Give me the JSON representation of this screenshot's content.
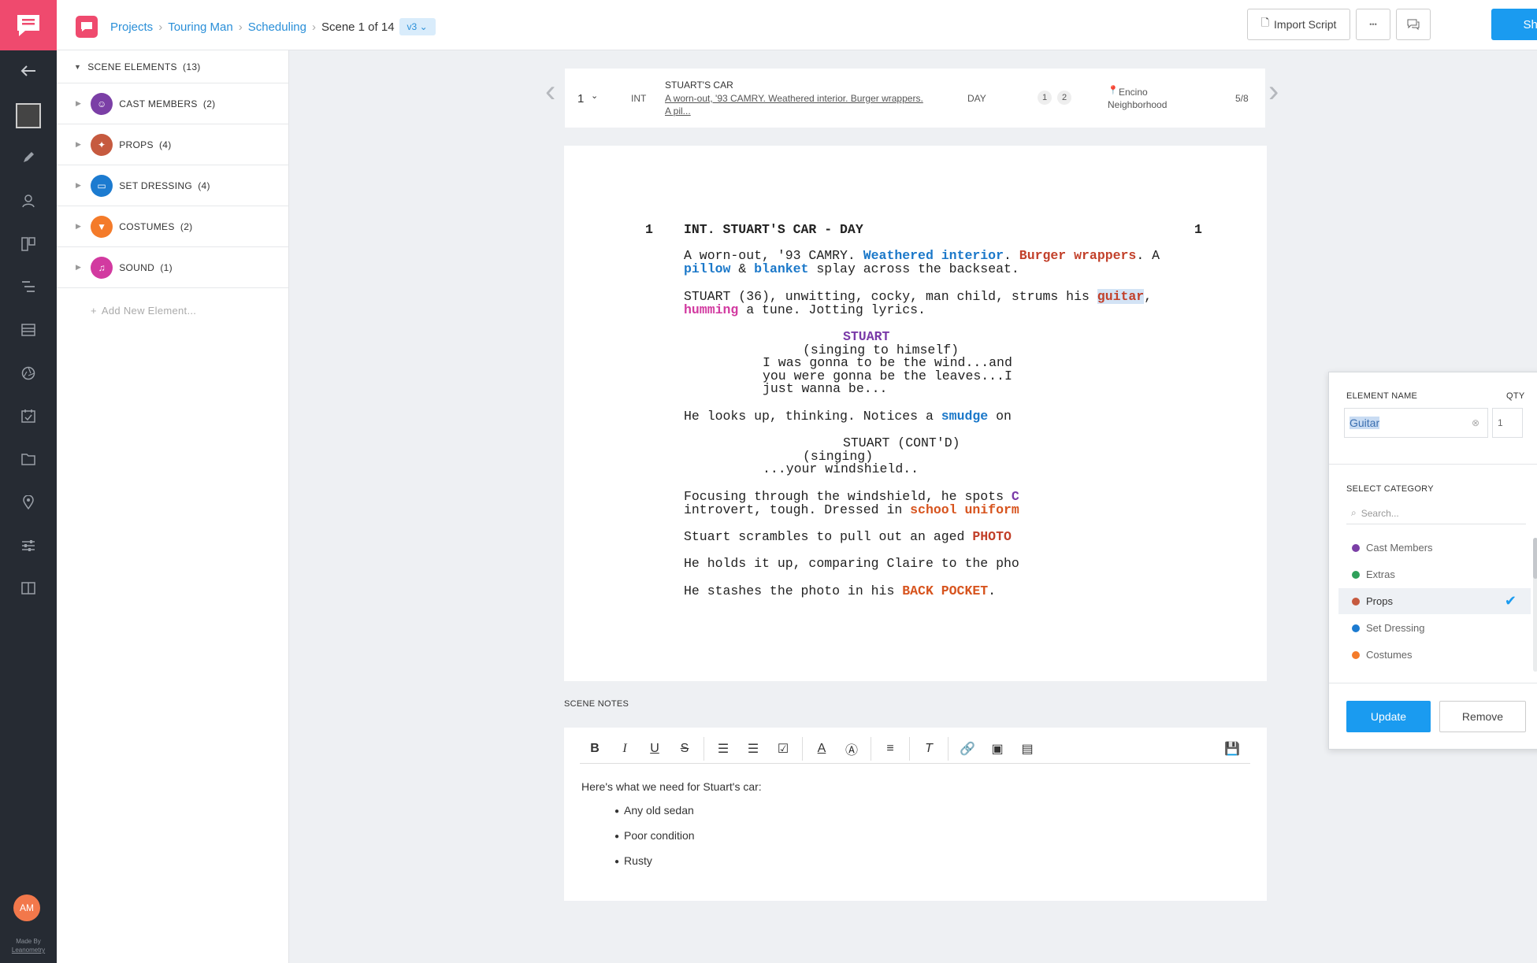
{
  "breadcrumb": {
    "projects": "Projects",
    "project": "Touring Man",
    "section": "Scheduling",
    "scene": "Scene 1 of 14",
    "version": "v3"
  },
  "toolbar": {
    "import": "Import Script",
    "more": "•••",
    "share": "Share"
  },
  "rail": {
    "avatar": "AM",
    "made_by": "Made By",
    "maker": "Leanometry"
  },
  "sidebar": {
    "header": "SCENE ELEMENTS  (13)",
    "categories": [
      {
        "label": "CAST MEMBERS  (2)",
        "color": "#7b3fa6"
      },
      {
        "label": "PROPS  (4)",
        "color": "#c65a3f"
      },
      {
        "label": "SET DRESSING  (4)",
        "color": "#1c7bd0"
      },
      {
        "label": "COSTUMES  (2)",
        "color": "#f47b2a"
      },
      {
        "label": "SOUND  (1)",
        "color": "#d23aa0"
      }
    ],
    "add": "Add New Element..."
  },
  "scene_strip": {
    "number": "1",
    "int_ext": "INT",
    "set": "STUART'S CAR",
    "desc_line1": "A worn-out, '93 CAMRY. Weathered interior. Burger wrappers.",
    "desc_line2": "A pil...",
    "time": "DAY",
    "cast1": "1",
    "cast2": "2",
    "location_line1": "Encino",
    "location_line2": "Neighborhood",
    "pages": "5/8"
  },
  "script": {
    "scene_num": "1",
    "slug": "INT. STUART'S CAR - DAY",
    "a1": "A worn-out, '93 CAMRY. ",
    "a1b": "Weathered interior",
    "a1c": ". ",
    "a1d": "Burger wrappers",
    "a1e": ". A",
    "a2": "pillow",
    "a2b": " & ",
    "a2c": "blanket",
    "a2d": " splay across the backseat.",
    "b1": "STUART (36), unwitting, cocky, man child, strums his ",
    "b1b": "guitar",
    "b1c": ",",
    "b2": "humming",
    "b2b": " a tune. Jotting lyrics.",
    "c1": "STUART",
    "c2": "(singing to himself)",
    "c3": "I was gonna to be the wind...and",
    "c4": "you were gonna be the leaves...I",
    "c5": "just wanna be...",
    "d1": "He looks up, thinking. Notices a ",
    "d1b": "smudge",
    "d1c": " on",
    "e1": "STUART (CONT'D)",
    "e2": "(singing)",
    "e3": "...your windshield..",
    "f1": "Focusing through the windshield, he spots ",
    "f1b": "C",
    "f2": "introvert, tough. Dressed in ",
    "f2b": "school uniform",
    "g1": "Stuart scrambles to pull out an aged ",
    "g1b": "PHOTO",
    "h1": "He holds it up, comparing Claire to the pho",
    "i1": "He stashes the photo in his ",
    "i1b": "BACK POCKET",
    "i1c": "."
  },
  "popover": {
    "name_label": "ELEMENT NAME",
    "qty_label": "QTY",
    "name_value": "Guitar",
    "qty_value": "1",
    "cat_label": "SELECT CATEGORY",
    "search_placeholder": "Search...",
    "options": [
      {
        "label": "Cast Members",
        "color": "#7b3fa6"
      },
      {
        "label": "Extras",
        "color": "#2fa05a"
      },
      {
        "label": "Props",
        "color": "#c65a3f"
      },
      {
        "label": "Set Dressing",
        "color": "#1c7bd0"
      },
      {
        "label": "Costumes",
        "color": "#f47b2a"
      }
    ],
    "update": "Update",
    "remove": "Remove"
  },
  "notes": {
    "label": "SCENE NOTES",
    "intro": "Here's what we need for Stuart's car:",
    "items": [
      "Any old sedan",
      "Poor condition",
      "Rusty"
    ]
  }
}
